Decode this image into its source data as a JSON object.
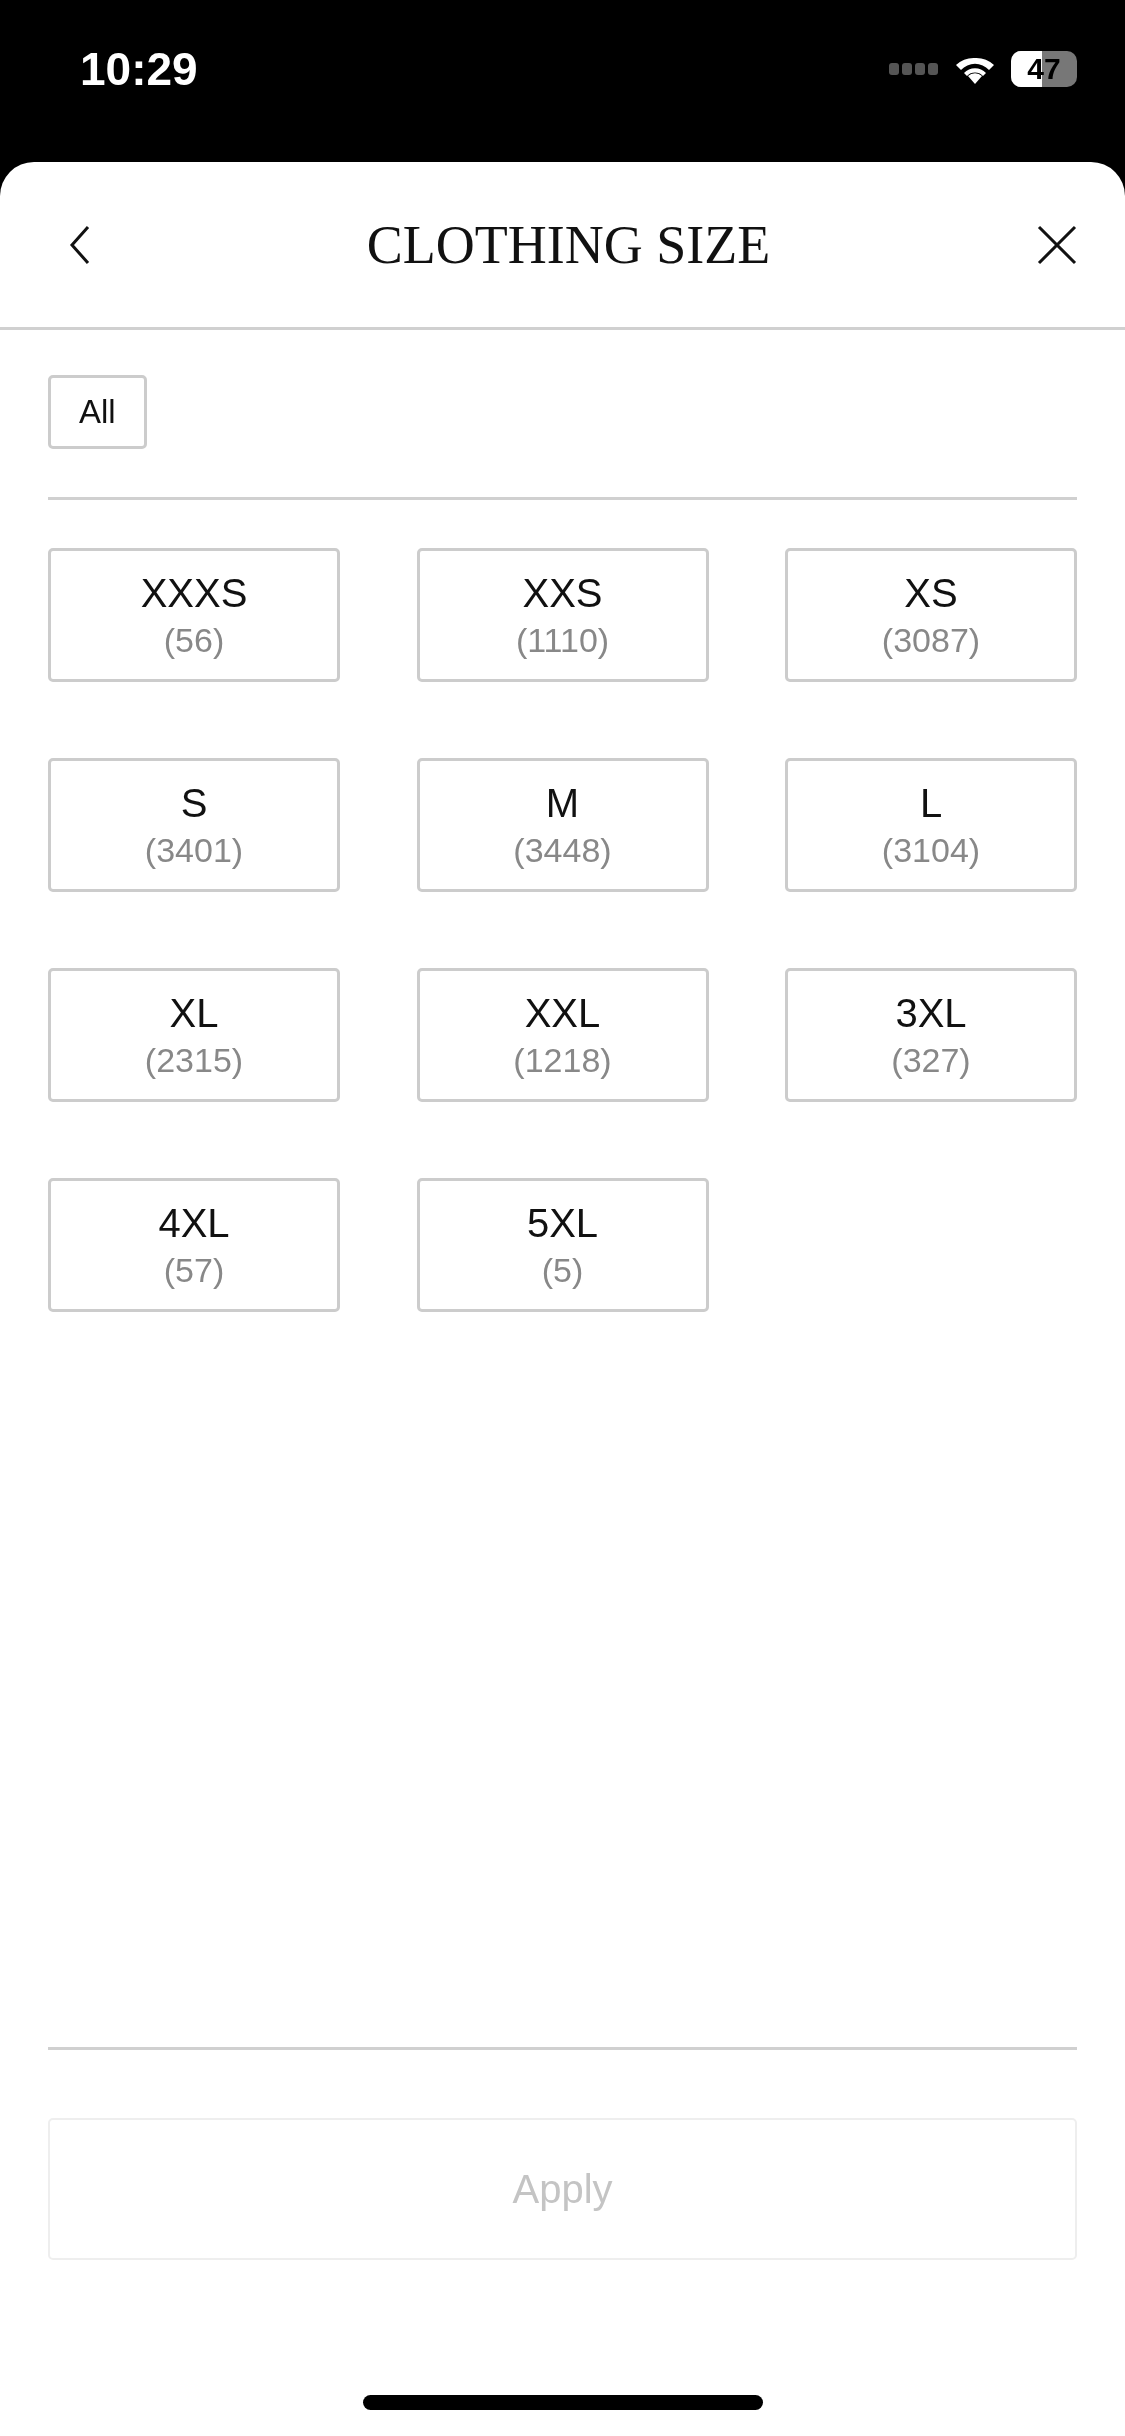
{
  "status_bar": {
    "time": "10:29",
    "battery": "47"
  },
  "header": {
    "title": "CLOTHING SIZE"
  },
  "all_option": {
    "label": "All",
    "selected": false
  },
  "sizes": [
    {
      "label": "XXXS",
      "count": "(56)",
      "selected": false
    },
    {
      "label": "XXS",
      "count": "(1110)",
      "selected": false
    },
    {
      "label": "XS",
      "count": "(3087)",
      "selected": false
    },
    {
      "label": "S",
      "count": "(3401)",
      "selected": false
    },
    {
      "label": "M",
      "count": "(3448)",
      "selected": false
    },
    {
      "label": "L",
      "count": "(3104)",
      "selected": false
    },
    {
      "label": "XL",
      "count": "(2315)",
      "selected": false
    },
    {
      "label": "XXL",
      "count": "(1218)",
      "selected": false
    },
    {
      "label": "3XL",
      "count": "(327)",
      "selected": false
    },
    {
      "label": "4XL",
      "count": "(57)",
      "selected": false
    },
    {
      "label": "5XL",
      "count": "(5)",
      "selected": false
    }
  ],
  "apply_button": {
    "label": "Apply",
    "disabled": true
  }
}
